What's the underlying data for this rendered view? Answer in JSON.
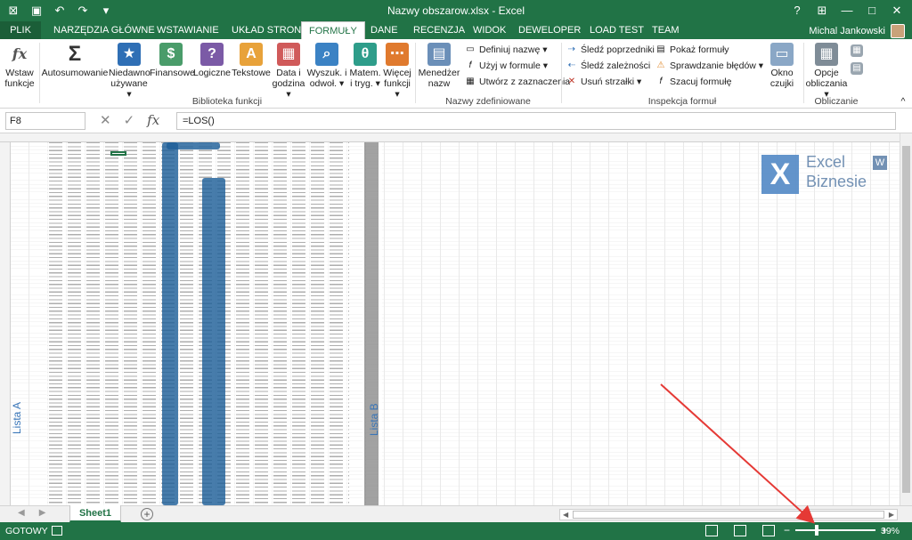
{
  "window": {
    "title": "Nazwy obszarow.xlsx - Excel",
    "help_label": "?",
    "minimize_label": "—",
    "restore_label": "□",
    "close_label": "✕"
  },
  "tabs": {
    "file": "PLIK",
    "items": [
      "NARZĘDZIA GŁÓWNE",
      "WSTAWIANIE",
      "UKŁAD STRONY",
      "FORMUŁY",
      "DANE",
      "RECENZJA",
      "WIDOK",
      "DEWELOPER",
      "LOAD TEST",
      "TEAM"
    ],
    "active": "FORMUŁY"
  },
  "user": {
    "name": "Michal Jankowski"
  },
  "ribbon": {
    "insert_function": [
      "Wstaw",
      "funkcje"
    ],
    "library": {
      "autosum": "Autosumowanie",
      "recent": [
        "Niedawno",
        "używane ▾"
      ],
      "financial": "Finansowe",
      "logical": "Logiczne",
      "text": "Tekstowe",
      "datetime": [
        "Data i",
        "godzina ▾"
      ],
      "lookup": [
        "Wyszuk. i",
        "odwoł. ▾"
      ],
      "math": [
        "Matem.",
        "i tryg. ▾"
      ],
      "more": [
        "Więcej",
        "funkcji ▾"
      ],
      "group_label": "Biblioteka funkcji"
    },
    "names": {
      "manager": [
        "Menedżer",
        "nazw"
      ],
      "define": "Definiuj nazwę ▾",
      "use_in_formula": "Użyj w formule ▾",
      "create_from_selection": "Utwórz z zaznaczenia",
      "group_label": "Nazwy zdefiniowane"
    },
    "auditing": {
      "trace_precedents": "Śledź poprzedniki",
      "trace_dependents": "Śledź zależności",
      "remove_arrows": "Usuń strzałki ▾",
      "show_formulas": "Pokaż formuły",
      "error_checking": "Sprawdzanie błędów ▾",
      "evaluate": "Szacuj formułę",
      "watch": [
        "Okno",
        "czujki"
      ],
      "group_label": "Inspekcja formuł"
    },
    "calculation": {
      "options": [
        "Opcje",
        "obliczania ▾"
      ],
      "group_label": "Obliczanie"
    }
  },
  "formula_bar": {
    "name_box": "F8",
    "cancel_icon": "✕",
    "enter_icon": "✓",
    "fx_icon": "fx",
    "formula": "=LOS()"
  },
  "sheet": {
    "range_labels": [
      "Lista A",
      "Lista B"
    ]
  },
  "logo": {
    "line1": "Excel",
    "badge": "W",
    "line2": "Biznesie"
  },
  "sheet_tabs": {
    "active": "Sheet1",
    "add_label": "+"
  },
  "status": {
    "ready": "GOTOWY",
    "zoom_minus": "−",
    "zoom_plus": "+",
    "zoom": "39%"
  },
  "colors": {
    "accent": "#217346",
    "annotation": "#e53935",
    "range_band": "#1f5f99"
  }
}
